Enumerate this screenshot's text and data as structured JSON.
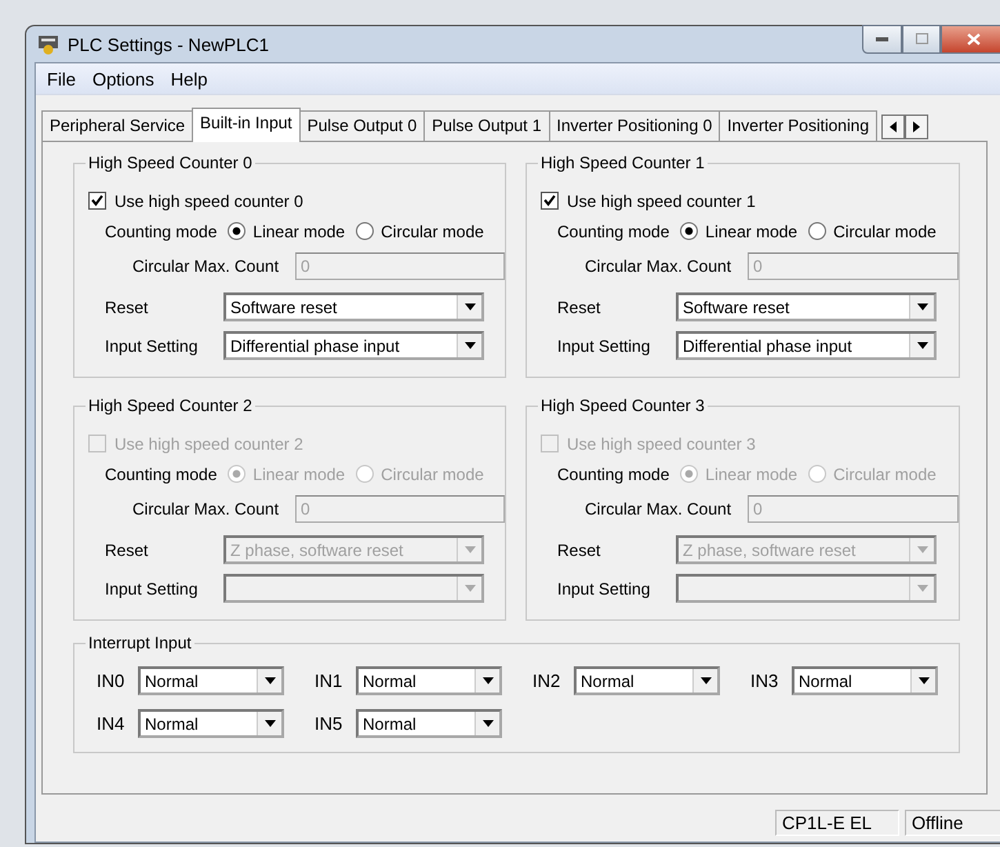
{
  "window": {
    "title": "PLC Settings - NewPLC1"
  },
  "menu": [
    "File",
    "Options",
    "Help"
  ],
  "tabs": [
    {
      "label": "Peripheral Service",
      "selected": false
    },
    {
      "label": "Built-in Input",
      "selected": true
    },
    {
      "label": "Pulse Output 0",
      "selected": false
    },
    {
      "label": "Pulse Output 1",
      "selected": false
    },
    {
      "label": "Inverter Positioning 0",
      "selected": false
    },
    {
      "label": "Inverter Positioning",
      "selected": false
    }
  ],
  "counters": [
    {
      "title": "High Speed Counter 0",
      "use_label": "Use high speed counter 0",
      "checked": true,
      "disabled": false,
      "counting_label": "Counting mode",
      "modes": [
        {
          "label": "Linear mode",
          "selected": true
        },
        {
          "label": "Circular mode",
          "selected": false
        }
      ],
      "max_label": "Circular Max. Count",
      "max_value": "0",
      "reset_label": "Reset",
      "reset_value": "Software reset",
      "input_label": "Input Setting",
      "input_value": "Differential phase input"
    },
    {
      "title": "High Speed Counter 1",
      "use_label": "Use high speed counter 1",
      "checked": true,
      "disabled": false,
      "counting_label": "Counting mode",
      "modes": [
        {
          "label": "Linear mode",
          "selected": true
        },
        {
          "label": "Circular mode",
          "selected": false
        }
      ],
      "max_label": "Circular Max. Count",
      "max_value": "0",
      "reset_label": "Reset",
      "reset_value": "Software reset",
      "input_label": "Input Setting",
      "input_value": "Differential phase input"
    },
    {
      "title": "High Speed Counter 2",
      "use_label": "Use high speed counter 2",
      "checked": false,
      "disabled": true,
      "counting_label": "Counting mode",
      "modes": [
        {
          "label": "Linear mode",
          "selected": true
        },
        {
          "label": "Circular mode",
          "selected": false
        }
      ],
      "max_label": "Circular Max. Count",
      "max_value": "0",
      "reset_label": "Reset",
      "reset_value": "Z phase, software reset",
      "input_label": "Input Setting"
    },
    {
      "title": "High Speed Counter 3",
      "use_label": "Use high speed counter 3",
      "checked": false,
      "disabled": true,
      "counting_label": "Counting mode",
      "modes": [
        {
          "label": "Linear mode",
          "selected": true
        },
        {
          "label": "Circular mode",
          "selected": false
        }
      ],
      "max_label": "Circular Max. Count",
      "max_value": "0",
      "reset_label": "Reset",
      "reset_value": "Z phase, software reset",
      "input_label": "Input Setting"
    }
  ],
  "interrupt": {
    "title": "Interrupt Input",
    "inputs": [
      {
        "label": "IN0",
        "value": "Normal"
      },
      {
        "label": "IN1",
        "value": "Normal"
      },
      {
        "label": "IN2",
        "value": "Normal"
      },
      {
        "label": "IN3",
        "value": "Normal"
      },
      {
        "label": "IN4",
        "value": "Normal"
      },
      {
        "label": "IN5",
        "value": "Normal"
      }
    ]
  },
  "status_bar": [
    "CP1L-E EL",
    "Offline"
  ]
}
